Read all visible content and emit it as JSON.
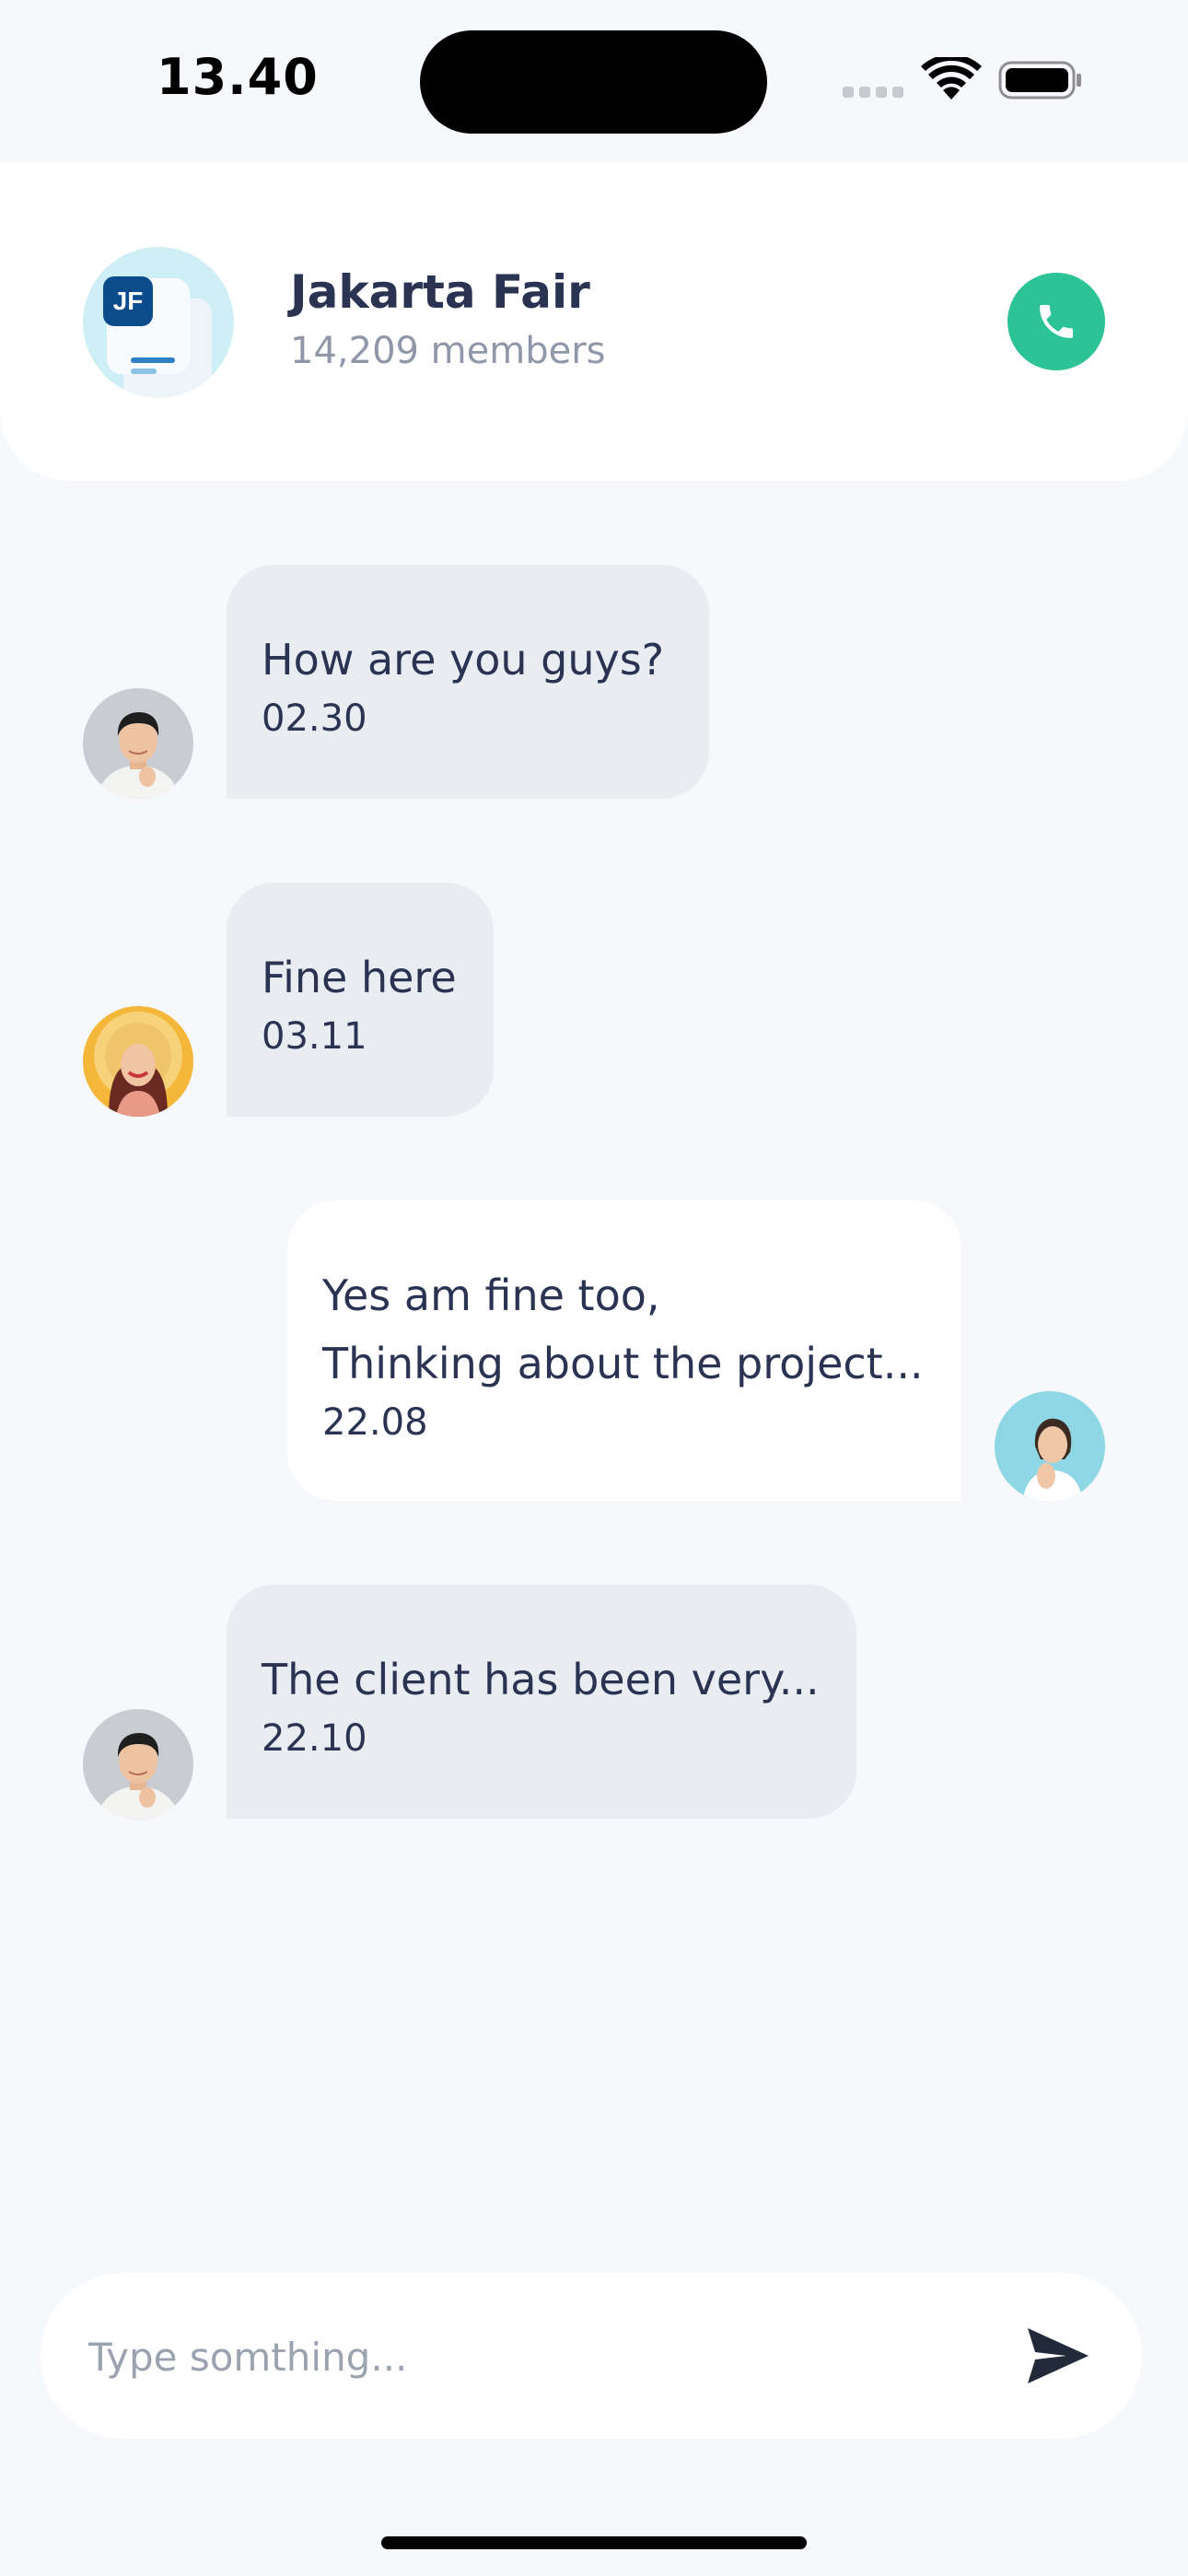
{
  "status_bar": {
    "time": "13.40"
  },
  "header": {
    "group_initials": "JF",
    "group_name": "Jakarta Fair",
    "member_count": "14,209 members"
  },
  "messages": [
    {
      "direction": "incoming",
      "sender_avatar": "man-avatar",
      "lines": [
        "How are you guys?"
      ],
      "time": "02.30"
    },
    {
      "direction": "incoming",
      "sender_avatar": "woman-hat-avatar",
      "lines": [
        "Fine here"
      ],
      "time": "03.11"
    },
    {
      "direction": "outgoing",
      "sender_avatar": "self-avatar",
      "lines": [
        "Yes am fine too,",
        "Thinking about the project..."
      ],
      "time": "22.08"
    },
    {
      "direction": "incoming",
      "sender_avatar": "man-avatar",
      "lines": [
        "The client has been very..."
      ],
      "time": "22.10"
    }
  ],
  "composer": {
    "placeholder": "Type somthing..."
  },
  "colors": {
    "background": "#F6F8FB",
    "incoming_bubble": "#E9EDF2",
    "outgoing_bubble": "#FFFFFF",
    "accent_call": "#2CC497",
    "text_primary": "#2A3352",
    "text_muted": "#8F97A8"
  },
  "icons": {
    "call": "phone-icon",
    "send": "send-icon"
  }
}
